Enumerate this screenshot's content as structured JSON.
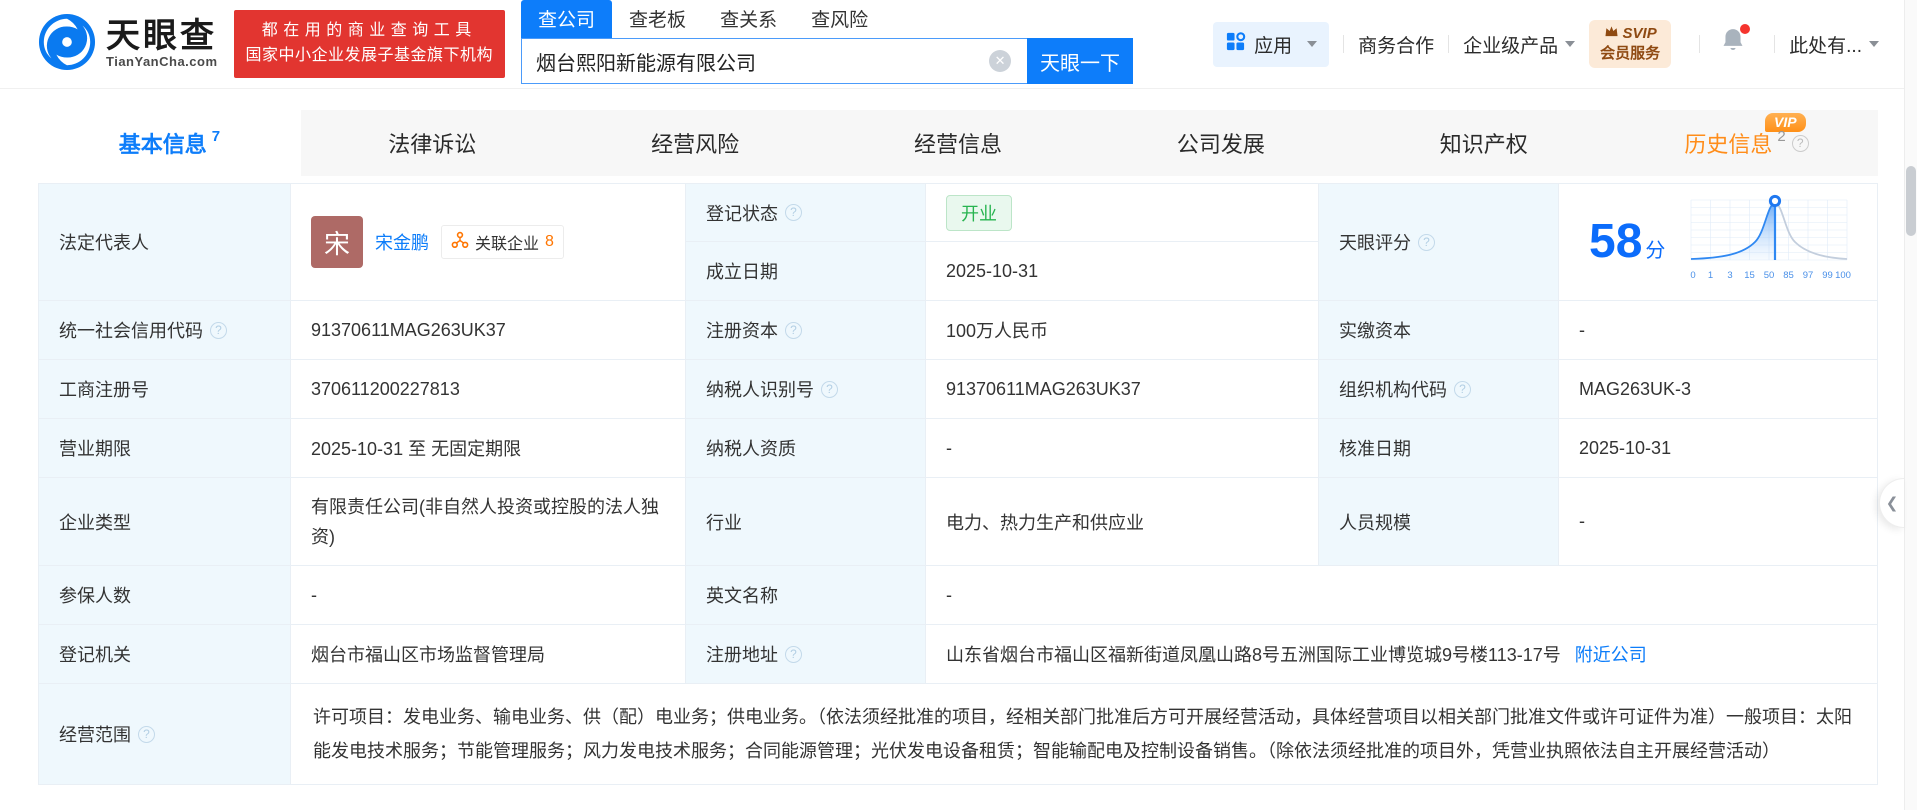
{
  "icons": {
    "caret_down": "",
    "clear": "✕",
    "question": "?",
    "chevron_left": "❮"
  },
  "header": {
    "brand": {
      "name": "天眼查",
      "domain": "TianYanCha.com"
    },
    "banner": {
      "line1": "都在用的商业查询工具",
      "line2": "国家中小企业发展子基金旗下机构"
    },
    "search": {
      "tabs": [
        {
          "label": "查公司"
        },
        {
          "label": "查老板"
        },
        {
          "label": "查关系"
        },
        {
          "label": "查风险"
        }
      ],
      "value": "烟台熙阳新能源有限公司",
      "button_label": "天眼一下"
    },
    "nav": {
      "apps_label": "应用",
      "biz_label": "商务合作",
      "enterprise_label": "企业级产品",
      "svip_line1": "SVIP",
      "svip_line2": "会员服务",
      "user_label": "此处有..."
    }
  },
  "tabs": [
    {
      "label": "基本信息",
      "count": "7"
    },
    {
      "label": "法律诉讼",
      "count": ""
    },
    {
      "label": "经营风险",
      "count": ""
    },
    {
      "label": "经营信息",
      "count": ""
    },
    {
      "label": "公司发展",
      "count": ""
    },
    {
      "label": "知识产权",
      "count": ""
    },
    {
      "label": "历史信息",
      "count": "2",
      "vip": "VIP"
    }
  ],
  "profile": {
    "legal_rep": {
      "label": "法定代表人",
      "avatar": "宋",
      "name": "宋金鹏",
      "related_label": "关联企业",
      "related_count": "8"
    },
    "score": {
      "label": "天眼评分",
      "value": "58",
      "unit": "分",
      "axis": [
        "0",
        "1",
        "3",
        "15",
        "50",
        "85",
        "97",
        "99",
        "100"
      ]
    },
    "fields": {
      "reg_status": {
        "label": "登记状态",
        "value": "开业"
      },
      "est_date": {
        "label": "成立日期",
        "value": "2025-10-31"
      },
      "credit_code": {
        "label": "统一社会信用代码",
        "value": "91370611MAG263UK37"
      },
      "reg_capital": {
        "label": "注册资本",
        "value": "100万人民币"
      },
      "paid_capital": {
        "label": "实缴资本",
        "value": "-"
      },
      "reg_number": {
        "label": "工商注册号",
        "value": "370611200227813"
      },
      "taxpayer_id": {
        "label": "纳税人识别号",
        "value": "91370611MAG263UK37"
      },
      "org_code": {
        "label": "组织机构代码",
        "value": "MAG263UK-3"
      },
      "business_term": {
        "label": "营业期限",
        "value": "2025-10-31 至 无固定期限"
      },
      "taxpayer_quality": {
        "label": "纳税人资质",
        "value": "-"
      },
      "approval_date": {
        "label": "核准日期",
        "value": "2025-10-31"
      },
      "company_type": {
        "label": "企业类型",
        "value": "有限责任公司(非自然人投资或控股的法人独资)"
      },
      "industry": {
        "label": "行业",
        "value": "电力、热力生产和供应业"
      },
      "staff_size": {
        "label": "人员规模",
        "value": "-"
      },
      "insured_count": {
        "label": "参保人数",
        "value": "-"
      },
      "english_name": {
        "label": "英文名称",
        "value": "-"
      },
      "reg_authority": {
        "label": "登记机关",
        "value": "烟台市福山区市场监督管理局"
      },
      "reg_address": {
        "label": "注册地址",
        "value": "山东省烟台市福山区福新街道凤凰山路8号五洲国际工业博览城9号楼113-17号",
        "link": "附近公司"
      },
      "business_scope": {
        "label": "经营范围",
        "value": "许可项目：发电业务、输电业务、供（配）电业务；供电业务。（依法须经批准的项目，经相关部门批准后方可开展经营活动，具体经营项目以相关部门批准文件或许可证件为准）一般项目：太阳能发电技术服务；节能管理服务；风力发电技术服务；合同能源管理；光伏发电设备租赁；智能输配电及控制设备销售。（除依法须经批准的项目外，凭营业执照依法自主开展经营活动）"
      }
    }
  }
}
